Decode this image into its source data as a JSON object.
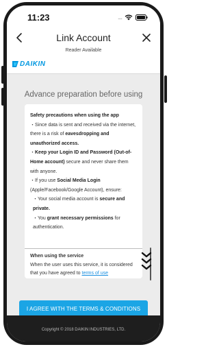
{
  "status_bar": {
    "time": "11:23",
    "signal_dots": "....",
    "icons": [
      "signal-dots",
      "wifi-icon",
      "battery-icon"
    ]
  },
  "nav": {
    "back_icon": "chevron-left-icon",
    "title": "Link Account",
    "close_icon": "close-icon",
    "subtitle": "Reader Available"
  },
  "brand": {
    "logo_text": "DAIKIN",
    "logo_color": "#0097e0"
  },
  "content": {
    "heading": "Advance preparation before using",
    "terms": {
      "safety_title": "Safety precautions when using the app",
      "p1_a": "・Since data is sent and received via the internet, there is a risk of ",
      "p1_b": "eavesdropping and unauthorized access.",
      "p2_bullet": "・",
      "p2_a": "Keep your Login ID and Password (Out-of-Home account)",
      "p2_b": " secure and never share them with anyone.",
      "p3_a": "・If you use ",
      "p3_b": "Social Media Login",
      "p3_c": " (Apple/Facebook/Google Account), ensure:",
      "p4_a": "・Your social media account is ",
      "p4_b": "secure and private.",
      "p5_a": "・You ",
      "p5_b": "grant necessary permissions",
      "p5_c": " for authentication.",
      "service_title": "When using the service",
      "service_text": "When the user uses this service, it is considered that you have agreed to ",
      "terms_link": "terms of use"
    },
    "scroll_icon": "double-chevron-down-icon"
  },
  "actions": {
    "agree_label": "I AGREE WITH THE TERMS & CONDITIONS",
    "agree_color": "#1ba5e5"
  },
  "footer": {
    "copyright": "Copyright © 2018 DAIKIN INDUSTRIES, LTD."
  }
}
